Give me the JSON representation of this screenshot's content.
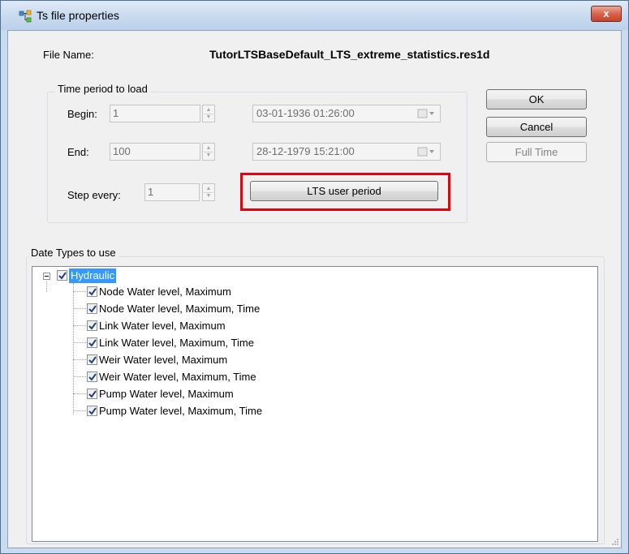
{
  "window": {
    "title": "Ts file properties",
    "close_glyph": "x"
  },
  "file": {
    "label": "File Name:",
    "value": "TutorLTSBaseDefault_LTS_extreme_statistics.res1d"
  },
  "time_period": {
    "group_title": "Time period  to load",
    "begin_label": "Begin:",
    "begin_value": "1",
    "begin_date": "03-01-1936 01:26:00",
    "end_label": "End:",
    "end_value": "100",
    "end_date": "28-12-1979 15:21:00",
    "step_label": "Step every:",
    "step_value": "1",
    "lts_button": "LTS user period"
  },
  "buttons": {
    "ok": "OK",
    "cancel": "Cancel",
    "full_time": "Full Time"
  },
  "data_types": {
    "group_title": "Date Types to use",
    "root": {
      "label": "Hydraulic",
      "checked": true
    },
    "items": [
      {
        "label": "Node Water level, Maximum",
        "checked": true
      },
      {
        "label": "Node Water level, Maximum, Time",
        "checked": true
      },
      {
        "label": "Link Water level, Maximum",
        "checked": true
      },
      {
        "label": "Link Water level, Maximum, Time",
        "checked": true
      },
      {
        "label": "Weir Water level, Maximum",
        "checked": true
      },
      {
        "label": "Weir Water level, Maximum, Time",
        "checked": true
      },
      {
        "label": "Pump Water level, Maximum",
        "checked": true
      },
      {
        "label": "Pump Water level, Maximum, Time",
        "checked": true
      }
    ]
  },
  "colors": {
    "highlight": "#e8000d",
    "selection": "#3399ff"
  },
  "icons": {
    "app": "tree-nodes-icon",
    "close": "close-icon",
    "spinner": "spinner-arrows-icon",
    "date_dropdown": "calendar-dropdown-icon",
    "checkbox": "checkmark-icon",
    "expander": "collapse-minus-icon"
  }
}
